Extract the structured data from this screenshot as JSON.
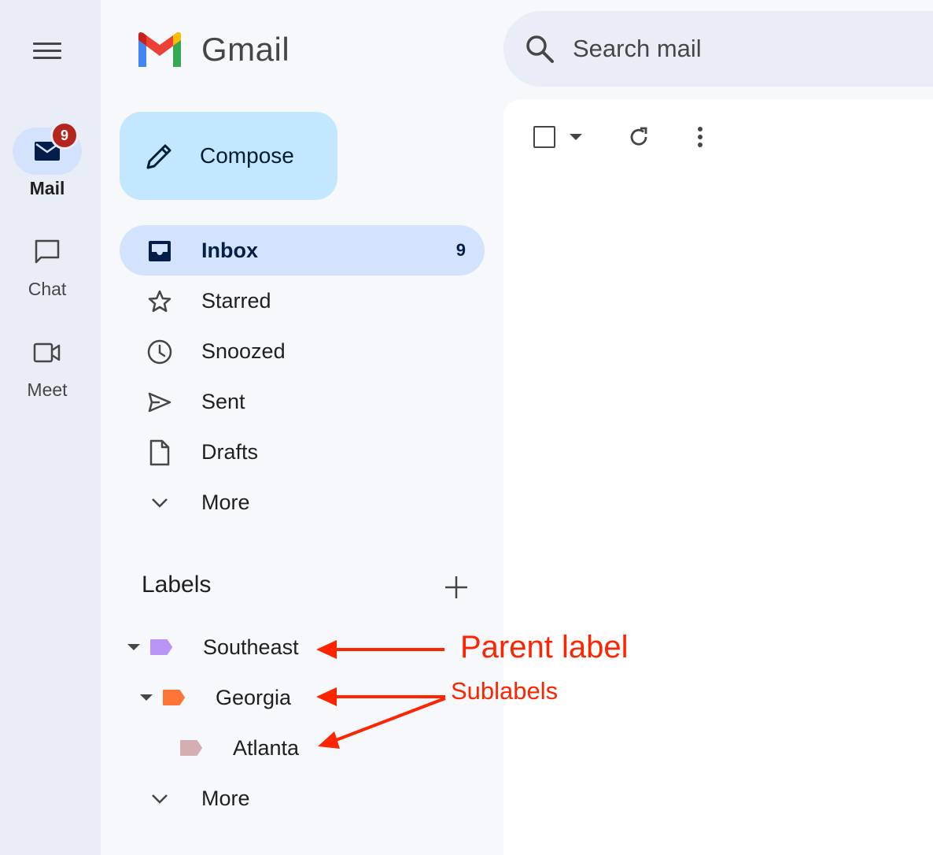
{
  "rail": {
    "items": [
      {
        "label": "Mail",
        "badge": "9"
      },
      {
        "label": "Chat"
      },
      {
        "label": "Meet"
      }
    ]
  },
  "header": {
    "logo_text": "Gmail",
    "search_placeholder": "Search mail"
  },
  "compose": {
    "label": "Compose"
  },
  "nav": {
    "items": [
      {
        "label": "Inbox",
        "count": "9",
        "icon": "inbox-icon"
      },
      {
        "label": "Starred",
        "icon": "star-icon"
      },
      {
        "label": "Snoozed",
        "icon": "clock-icon"
      },
      {
        "label": "Sent",
        "icon": "send-icon"
      },
      {
        "label": "Drafts",
        "icon": "draft-icon"
      },
      {
        "label": "More",
        "icon": "chevron-down-icon"
      }
    ]
  },
  "labels": {
    "title": "Labels",
    "items": [
      {
        "label": "Southeast",
        "color": "#b794f6"
      },
      {
        "label": "Georgia",
        "color": "#ff7537"
      },
      {
        "label": "Atlanta",
        "color": "#d5aeb3"
      }
    ],
    "more": "More"
  },
  "annotations": {
    "parent": "Parent label",
    "sub": "Sublabels",
    "color": "#ff2400"
  }
}
